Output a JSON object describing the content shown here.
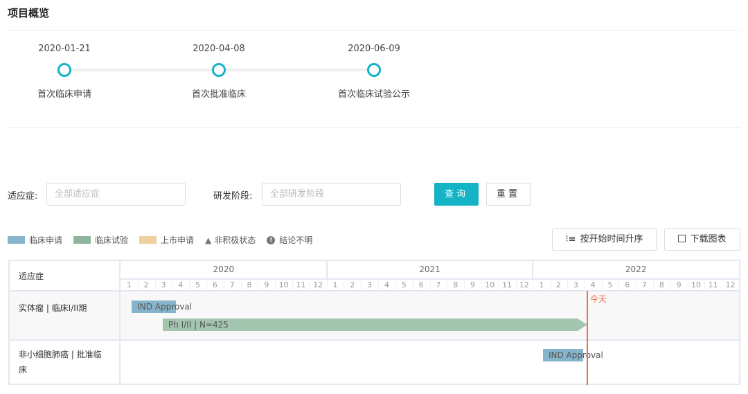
{
  "section_title": "项目概览",
  "milestones": [
    {
      "date": "2020-01-21",
      "label": "首次临床申请"
    },
    {
      "date": "2020-04-08",
      "label": "首次批准临床"
    },
    {
      "date": "2020-06-09",
      "label": "首次临床试验公示"
    }
  ],
  "filters": {
    "indication_label": "适应症:",
    "indication_placeholder": "全部适应症",
    "stage_label": "研发阶段:",
    "stage_placeholder": "全部研发阶段",
    "query_button": "查询",
    "reset_button": "重置"
  },
  "legend": [
    {
      "label": "临床申请",
      "color": "#86b4cb"
    },
    {
      "label": "临床试验",
      "color": "#8fb59c"
    },
    {
      "label": "上市申请",
      "color": "#f0cf9f"
    },
    {
      "label": "非积极状态",
      "icon": "triangle-icon"
    },
    {
      "label": "结论不明",
      "icon": "exclamation-circle-icon"
    }
  ],
  "toolbar": {
    "sort_button": "按开始时间升序",
    "download_button": "下载图表"
  },
  "gantt": {
    "header_label": "适应症",
    "years": [
      "2020",
      "2021",
      "2022"
    ],
    "months": [
      "1",
      "2",
      "3",
      "4",
      "5",
      "6",
      "7",
      "8",
      "9",
      "10",
      "11",
      "12"
    ],
    "today_label": "今天",
    "today": "2022-04-06",
    "today_color": "#f07050",
    "rows": [
      {
        "label": "实体瘤 | 临床I/II期",
        "bars": [
          {
            "text": "IND Approval",
            "start": "2020-01-21",
            "end": "2020-04-08",
            "color": "#86b4cb",
            "arrow": false
          },
          {
            "text": "Ph I/II | N=425",
            "start": "2020-03-15",
            "end": "2022-04-06",
            "color": "#a3c5b0",
            "arrow": true
          }
        ]
      },
      {
        "label": "非小细胞肺癌 | 批准临床",
        "bars": [
          {
            "text": "IND Approval",
            "start": "2022-01-19",
            "end": "2022-03-29",
            "color": "#86b4cb",
            "arrow": false
          }
        ]
      }
    ]
  }
}
